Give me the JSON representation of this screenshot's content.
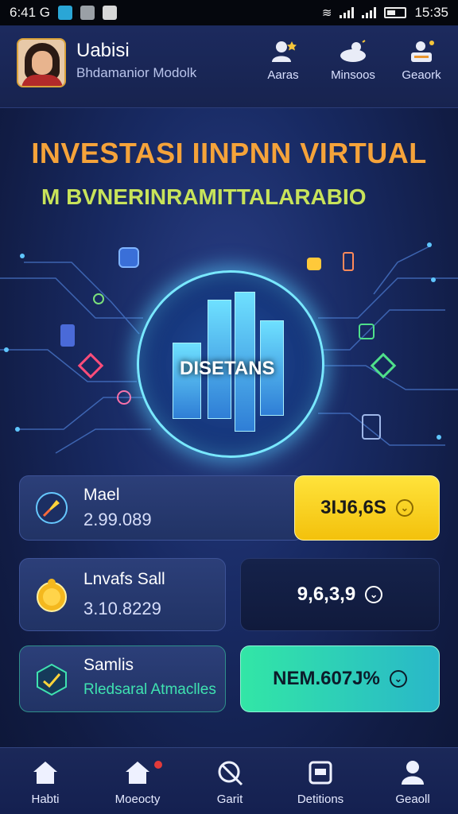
{
  "status_bar": {
    "time_left": "6:41 G",
    "time_right": "15:35"
  },
  "header": {
    "profile_name": "Uabisi",
    "profile_subtitle": "Bhdamanior Modolk",
    "nav": [
      {
        "label": "Aaras",
        "icon": "user-star-icon"
      },
      {
        "label": "Minsoos",
        "icon": "cloud-user-icon"
      },
      {
        "label": "Geaork",
        "icon": "user-card-icon"
      }
    ]
  },
  "hero": {
    "title": "INVESTASI IINPNN VIRTUAL",
    "subtitle": "M BVNERINRAMITTALARABIO",
    "badge_text": "DISETANS"
  },
  "cards": [
    {
      "title": "Mael",
      "value": "2.99.089",
      "icon": "compass-icon",
      "amount": "3IJ6,6S",
      "style": "yellow"
    },
    {
      "title": "Lnvafs Sall",
      "value": "3.10.8229",
      "icon": "coin-icon",
      "amount": "9,6,3,9",
      "style": "dark"
    },
    {
      "title": "Samlis",
      "value": "Rledsaral Atmaclles",
      "icon": "chart-check-icon",
      "amount": "NEM.607J%",
      "style": "teal"
    }
  ],
  "bottom_nav": [
    {
      "label": "Habti",
      "icon": "home-icon"
    },
    {
      "label": "Moeocty",
      "icon": "home-badge-icon"
    },
    {
      "label": "Garit",
      "icon": "search-slash-icon"
    },
    {
      "label": "Detitions",
      "icon": "wallet-icon"
    },
    {
      "label": "Geaoll",
      "icon": "person-icon"
    }
  ],
  "colors": {
    "background": "#14204a",
    "accent_yellow": "#f3c10c",
    "accent_teal": "#32e6a6",
    "title_orange": "#f5a33a"
  }
}
